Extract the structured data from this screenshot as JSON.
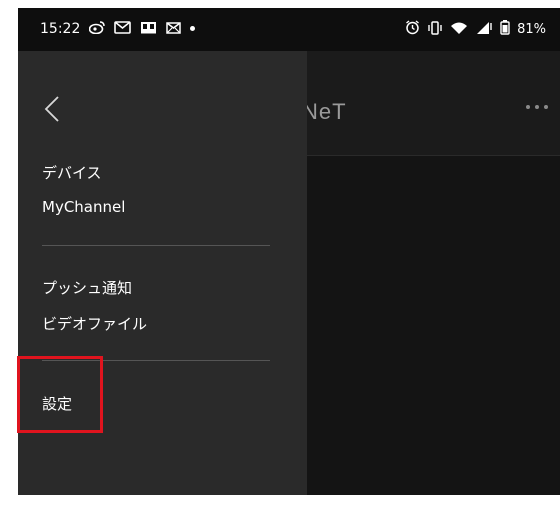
{
  "status_bar": {
    "time": "15:22",
    "left_icons": [
      "weibo-icon",
      "gmail-icon",
      "book-icon",
      "mail-icon",
      "notification-dot"
    ],
    "right_icons": [
      "alarm-icon",
      "vibrate-icon",
      "wifi-icon",
      "signal-icon",
      "battery-icon"
    ],
    "battery": "81%"
  },
  "app_header": {
    "title_partial": "NeT",
    "more_icon": "more-dots-icon"
  },
  "drawer": {
    "back_icon": "chevron-left-icon",
    "group1": [
      "デバイス",
      "MyChannel"
    ],
    "group2": [
      "プッシュ通知",
      "ビデオファイル"
    ],
    "group3": [
      "設定"
    ]
  },
  "colors": {
    "drawer_bg": "#2a2a2a",
    "screen_bg": "#141414",
    "highlight": "#e0141e"
  }
}
